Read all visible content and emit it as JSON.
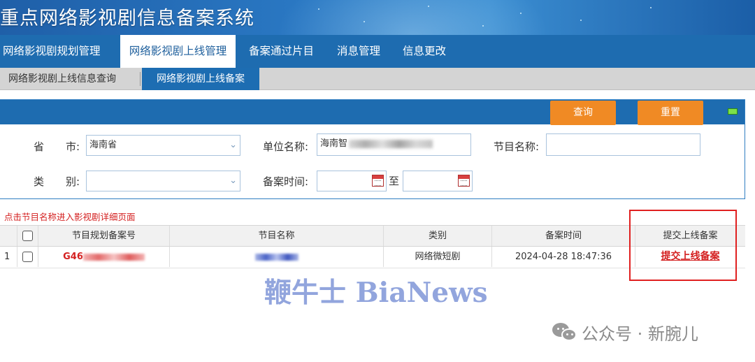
{
  "header": {
    "title": "重点网络影视剧信息备案系统"
  },
  "main_nav": [
    {
      "label": "网络影视剧规划管理"
    },
    {
      "label": "网络影视剧上线管理"
    },
    {
      "label": "备案通过片目"
    },
    {
      "label": "消息管理"
    },
    {
      "label": "信息更改"
    }
  ],
  "main_nav_active": "网络影视剧上线管理",
  "sub_nav": [
    {
      "label": "网络影视剧上线信息查询"
    },
    {
      "label": "网络影视剧上线备案"
    }
  ],
  "sub_nav_active": "网络影视剧上线备案",
  "search": {
    "query_button": "查询",
    "reset_button": "重置",
    "province_label_1": "省",
    "province_label_2": "市:",
    "province_value": "海南省",
    "unit_label": "单位名称:",
    "unit_value_visible": "海南智",
    "program_label": "节目名称:",
    "program_value": "",
    "category_label_1": "类",
    "category_label_2": "别:",
    "category_value": "",
    "time_label": "备案时间:",
    "time_to": "至",
    "time_from_value": "",
    "time_to_value": ""
  },
  "hint": "点击节目名称进入影视剧详细页面",
  "table": {
    "columns": [
      "节目规划备案号",
      "节目名称",
      "类别",
      "备案时间",
      "提交上线备案"
    ],
    "rows": [
      {
        "index": "1",
        "code_visible": "G46",
        "category": "网络微短剧",
        "time": "2024-04-28 18:47:36",
        "action": "提交上线备案"
      }
    ]
  },
  "watermarks": {
    "bianews": "鞭牛士 BiaNews",
    "wechat": "公众号 · 新腕儿"
  },
  "colors": {
    "nav_blue": "#1e6cb0",
    "button_orange": "#f08a24",
    "alert_red": "#d42020",
    "highlight_box": "#e02020"
  },
  "icons": {
    "dropdown": "chevron-down-icon",
    "calendar": "calendar-icon",
    "collapse": "collapse-icon",
    "wechat": "wechat-icon"
  }
}
